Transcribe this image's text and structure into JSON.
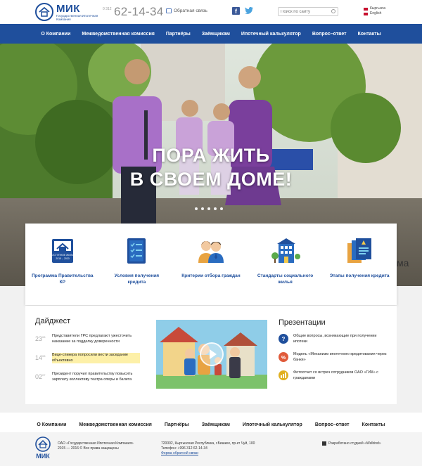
{
  "header": {
    "logo_title": "МИК",
    "logo_subtitle": "Государственная Ипотечная Компания",
    "phone_code": "0 312",
    "phone": "62-14-34",
    "callback": "Обратная связь",
    "search_placeholder": "Поиск по сайту",
    "languages": [
      "Кыргызча",
      "English"
    ]
  },
  "nav": {
    "items": [
      "О Компании",
      "Межведомственная комиссия",
      "Партнёры",
      "Заёмщикам",
      "Ипотечный калькулятор",
      "Вопрос–ответ",
      "Контакты"
    ]
  },
  "hero": {
    "line1": "ПОРА ЖИТЬ",
    "line2": "В СВОЕМ ДОМЕ!",
    "partial_word": "ма"
  },
  "features": [
    {
      "label": "Программа Правительства КР",
      "icon": "affordable-housing-icon",
      "icon_text": "ДОСТУПНОЕ ЖИЛЬЕ 2015 – 2020"
    },
    {
      "label": "Условия получения кредита",
      "icon": "checklist-icon"
    },
    {
      "label": "Критерии отбора граждан",
      "icon": "couple-icon"
    },
    {
      "label": "Стандарты социального жилья",
      "icon": "apartment-building-icon"
    },
    {
      "label": "Этапы получения кредита",
      "icon": "documents-icon"
    }
  ],
  "digest": {
    "title": "Дайджест",
    "items": [
      {
        "day": "23",
        "month": "08",
        "text": "Представители ГРС предлагают ужесточить наказание за подделку доверенности",
        "highlight": false
      },
      {
        "day": "14",
        "month": "08",
        "text": "Вице-спикера попросили вести заседание объективно",
        "highlight": true
      },
      {
        "day": "02",
        "month": "07",
        "text": "Президент поручил правительству повысить зарплату коллективу театра оперы и балета",
        "highlight": false
      }
    ]
  },
  "presentations": {
    "title": "Презентации",
    "items": [
      {
        "text": "Общие вопросы, возникающие при получении ипотеки",
        "icon": "question-icon",
        "color": "#1f4f9c"
      },
      {
        "text": "Модель «Механизм ипотечного кредитования через банки»",
        "icon": "percent-icon",
        "color": "#e05a3a"
      },
      {
        "text": "Фотоотчет со встреч сотрудников ОАО «ГИК» с гражданами",
        "icon": "chart-icon",
        "color": "#e0b020"
      }
    ]
  },
  "footer": {
    "nav": [
      "О Компании",
      "Межведомственная комиссия",
      "Партнёры",
      "Заёмщикам",
      "Ипотечный калькулятор",
      "Вопрос–ответ",
      "Контакты"
    ],
    "logo_title": "МИК",
    "copyright_line1": "ОАО «Государственная Ипотечная Компания»",
    "copyright_line2": "2015 — 2016 © Все права защищены",
    "address_line1": "720002, Кыргызская Республика, г.Бишкек, пр-кт Чуй, 100",
    "address_line2": "Телефон: +996 312 62-14-34",
    "feedback_link": "Форма обратной связи",
    "developer": "Разработано студией «Welbind»"
  },
  "colors": {
    "brand_blue": "#1f4f9c",
    "nav_text": "#ffffff"
  }
}
